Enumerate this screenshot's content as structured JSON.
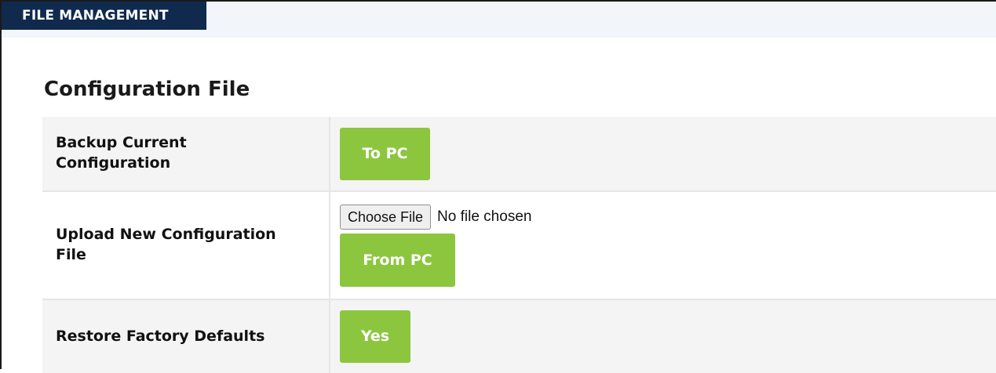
{
  "header": {
    "section_title": "FILE MANAGEMENT"
  },
  "config": {
    "heading": "Configuration File",
    "rows": [
      {
        "label_line1": "Backup Current",
        "label_line2": "Configuration",
        "button": "To PC"
      },
      {
        "label_line1": "Upload New Configuration",
        "label_line2": "File",
        "choose_file_label": "Choose File",
        "file_status": "No file chosen",
        "button": "From PC"
      },
      {
        "label": "Restore Factory Defaults",
        "button": "Yes"
      }
    ]
  },
  "colors": {
    "header_bg": "#102a4e",
    "button_green": "#8cc63f",
    "row_alt": "#f4f4f4"
  }
}
